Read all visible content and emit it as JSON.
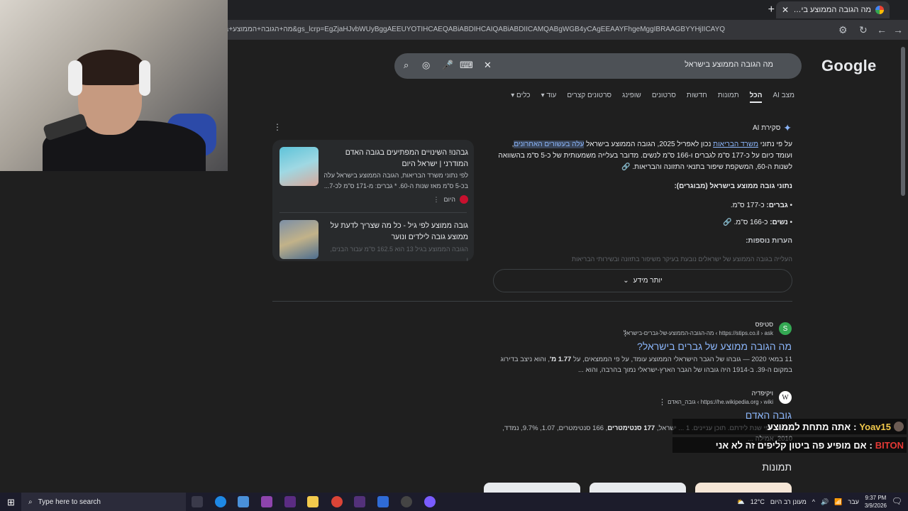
{
  "browser": {
    "tab_title": "מה הגובה הממוצע בישראל - ח",
    "url": "מה+הגובה+הממוצע+בישראל&rlz=1C1VDKB_iwIL1154IL1154&oq=מה+הגובה+הממוצע+בישראל&gs_lcrp=EgZjaHJvbWUyBggAEEUYOTIHCAEQABiABDIHCAIQABiABDIICAMQABgWGB4yCAgEEAAYFhgeMggIBRAAGBYYHjIICAYQ"
  },
  "google": {
    "logo": "Google",
    "query": "מה הגובה הממוצע בישראל",
    "tabs": [
      "מצב AI",
      "הכל",
      "תמונות",
      "חדשות",
      "סרטונים",
      "שופינג",
      "סרטונים קצרים",
      "עוד",
      "כלים"
    ]
  },
  "ai_overview": {
    "title": "סקירת AI",
    "para_1": "על פי נתוני ",
    "link_1": "משרד הבריאות",
    "para_2": " נכון לאפריל 2025, הגובה הממוצע בישראל ",
    "highlight": "עלה בעשורים האחרונים",
    "para_3": ", ועומד כיום על כ-177 ס\"מ לגברים ו-166 ס\"מ לנשים. מדובר בעלייה משמעותית של כ-5 ס\"מ בהשוואה לשנות ה-60, המשקפת שיפור בתנאי התזונה והבריאות.",
    "data_heading": "נתוני גובה ממוצע בישראל (מבוגרים):",
    "men_label": "גברים:",
    "men_value": " כ-177 ס\"מ.",
    "women_label": "נשים:",
    "women_value": " כ-166 ס\"מ.",
    "notes_heading": "הערות נוספות:",
    "faded_text": "העלייה בגובה הממוצע של ישראלים נובעת בעיקר משיפור בתזונה ובשירותי הבריאות",
    "more_button": "יותר מידע"
  },
  "cards": [
    {
      "title": "גבהנו! השינויים המפתיעים בגובה האדם המודרני | ישראל היום",
      "desc": "לפי נתוני משרד הבריאות, הגובה הממוצע בישראל עלה בכ-5 ס\"מ מאז שנות ה-60. * גברים: מ-171 ס\"מ לכ-7...",
      "source": "היום"
    },
    {
      "title": "גובה ממוצע לפי גיל - כל מה שצריך לדעת על ממוצע גובה לילדים ונוער",
      "desc": "הגובה הממוצע בגיל 13 הוא 162.5 ס\"מ עבור הבנים, ו..."
    }
  ],
  "results": [
    {
      "site": "סטיפס",
      "url": "https://stips.co.il › ask › מה-הגובה-הממוצע-של-גברים-בישראל",
      "title": "מה הגובה ממוצע של גברים בישראל?",
      "snippet_1": "11 במאי 2020 — גובהו של הגבר הישראלי הממוצע עומד, על פי הממצאים, על ",
      "snippet_bold": "1.77 מ'",
      "snippet_2": ", והוא ניצב בדירוג במקום ה-39. ב-1914 היה גובהו של הגבר הארץ-ישראלי נמוך בהרבה, והוא ..."
    },
    {
      "site": "ויקיפדיה",
      "url": "https://he.wikipedia.org › wiki › גובה_האדם",
      "title": "גובה האדם",
      "snippet_1": "בעולם לפי שנת לידתם. תוכן עניינים. 1 ... ישראל, ",
      "snippet_bold": "177 סנטימטרים",
      "snippet_2": ", 166 סנטימטרים, 1.07, 9.7%, נמדד, 2010, אמילה ..."
    }
  ],
  "images_heading": "תמונות",
  "chat": [
    {
      "user": "Yoav15",
      "sep": ": ",
      "text": "אתה מתחת לממוצע"
    },
    {
      "user": "BITON",
      "sep": " : ",
      "text": "אם מופיע פה ביטון קליפים זה לא אני"
    }
  ],
  "taskbar": {
    "search_placeholder": "Type here to search",
    "weather": "12°C",
    "weather_desc": "מעונן רב היום",
    "lang": "עבר",
    "time": "9:37 PM",
    "date": "3/9/2026"
  },
  "colors": {
    "link": "#8ab4f8",
    "background": "#1f1f1f",
    "chat_user_1": "#f2c94c",
    "chat_user_2": "#e53935"
  }
}
